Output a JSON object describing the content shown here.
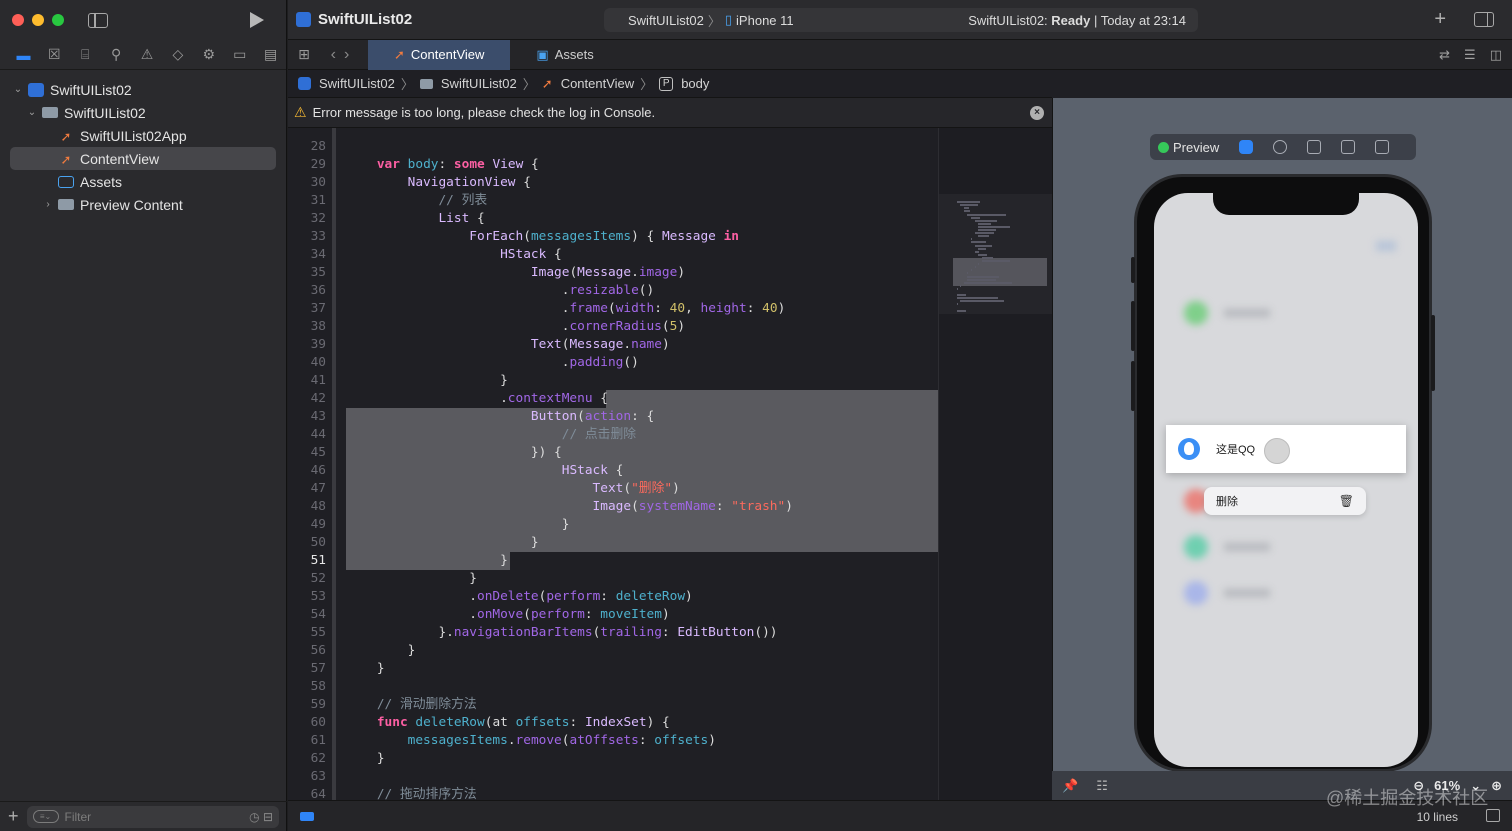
{
  "navigator": {
    "tree": [
      {
        "label": "SwiftUIList02",
        "level": 0,
        "expanded": true,
        "icon": "project-icon"
      },
      {
        "label": "SwiftUIList02",
        "level": 1,
        "expanded": true,
        "icon": "folder-icon"
      },
      {
        "label": "SwiftUIList02App",
        "level": 2,
        "icon": "swift-file-icon"
      },
      {
        "label": "ContentView",
        "level": 2,
        "icon": "swift-file-icon",
        "selected": true
      },
      {
        "label": "Assets",
        "level": 2,
        "icon": "assets-icon"
      },
      {
        "label": "Preview Content",
        "level": 2,
        "expanded": false,
        "icon": "folder-icon"
      }
    ],
    "filter_placeholder": "Filter"
  },
  "titlebar": {
    "project": "SwiftUIList02",
    "scheme_target": "SwiftUIList02",
    "scheme_device": "iPhone 11",
    "status_prefix": "SwiftUIList02:",
    "status_ready": "Ready",
    "status_suffix": "| Today at 23:14"
  },
  "tabs": [
    {
      "label": "ContentView",
      "active": true
    },
    {
      "label": "Assets",
      "active": false
    }
  ],
  "breadcrumb": [
    "SwiftUIList02",
    "SwiftUIList02",
    "ContentView",
    "body"
  ],
  "error_message": "Error message is too long, please check the log in Console.",
  "code": {
    "first_line": 28,
    "current_line": 51,
    "lines": [
      "",
      "    var body: some View {",
      "        NavigationView {",
      "            // 列表",
      "            List {",
      "                ForEach(messagesItems) { Message in",
      "                    HStack {",
      "                        Image(Message.image)",
      "                            .resizable()",
      "                            .frame(width: 40, height: 40)",
      "                            .cornerRadius(5)",
      "                        Text(Message.name)",
      "                            .padding()",
      "                    }",
      "                    .contextMenu {",
      "                        Button(action: {",
      "                            // 点击删除",
      "                        }) {",
      "                            HStack {",
      "                                Text(\"删除\")",
      "                                Image(systemName: \"trash\")",
      "                            }",
      "                        }",
      "                    }",
      "                }",
      "                .onDelete(perform: deleteRow)",
      "                .onMove(perform: moveItem)",
      "            }.navigationBarItems(trailing: EditButton())",
      "        }",
      "    }",
      "",
      "    // 滑动删除方法",
      "    func deleteRow(at offsets: IndexSet) {",
      "        messagesItems.remove(atOffsets: offsets)",
      "    }",
      "",
      "    // 拖动排序方法"
    ]
  },
  "preview": {
    "label": "Preview",
    "cell_text": "这是QQ",
    "menu_item": "删除",
    "zoom": "61%"
  },
  "status": {
    "line_count": "10 lines"
  },
  "watermark": "@稀土掘金技术社区"
}
